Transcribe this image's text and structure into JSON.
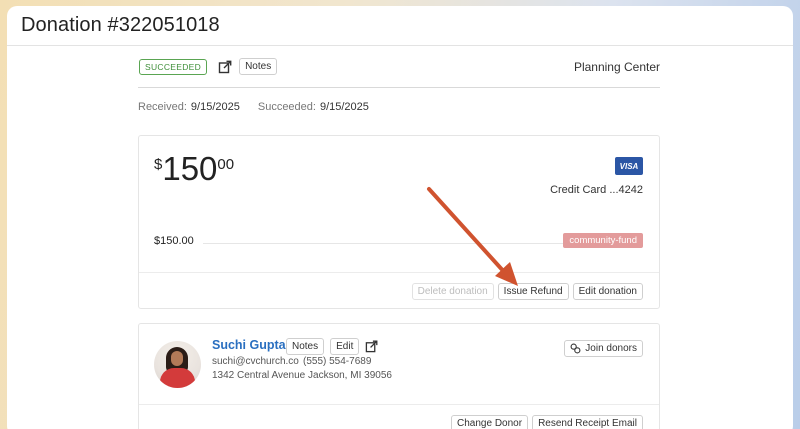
{
  "page": {
    "title": "Donation #322051018"
  },
  "status": {
    "badge": "SUCCEEDED",
    "notes_label": "Notes",
    "organization": "Planning Center",
    "icon": "external-link-icon"
  },
  "dates": {
    "received_label": "Received:",
    "received_value": "9/15/2025",
    "succeeded_label": "Succeeded:",
    "succeeded_value": "9/15/2025"
  },
  "amount": {
    "currency_symbol": "$",
    "whole": "150",
    "cents": "00",
    "line_total": "$150.00",
    "card_brand": "VISA",
    "card_text": "Credit Card ...4242",
    "fund": "community-fund"
  },
  "actions": {
    "delete_label": "Delete donation",
    "refund_label": "Issue Refund",
    "edit_label": "Edit donation"
  },
  "donor": {
    "name": "Suchi Gupta",
    "notes_label": "Notes",
    "edit_label": "Edit",
    "email": "suchi@cvchurch.co",
    "phone": "(555) 554-7689",
    "address": "1342 Central Avenue Jackson, MI 39056",
    "join_label": "Join donors",
    "change_label": "Change Donor",
    "resend_label": "Resend Receipt Email"
  },
  "colors": {
    "success": "#5aa552",
    "link": "#2a6fc0",
    "fund_badge": "#e39b9b",
    "visa": "#2b56a5",
    "annotation_arrow": "#d0532f"
  }
}
